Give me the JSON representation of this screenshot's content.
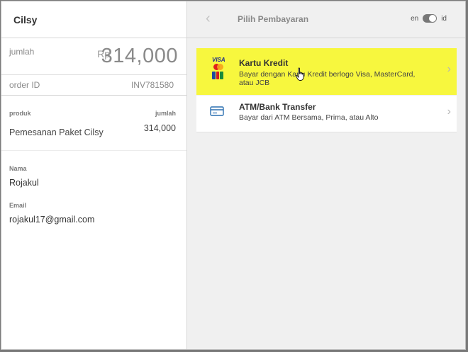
{
  "merchant": {
    "name": "Cilsy"
  },
  "summary": {
    "amount_label": "jumlah",
    "currency": "Rp",
    "amount": "314,000",
    "order_label": "order ID",
    "order_id": "INV781580"
  },
  "items": {
    "header_product": "produk",
    "header_amount": "jumlah",
    "rows": [
      {
        "name": "Pemesanan Paket Cilsy",
        "amount": "314,000"
      }
    ]
  },
  "customer": {
    "name_label": "Nama",
    "name": "Rojakul",
    "email_label": "Email",
    "email": "rojakul17@gmail.com"
  },
  "header": {
    "back_icon": "chevron-left-icon",
    "title": "Pilih Pembayaran",
    "lang_en": "en",
    "lang_id": "id"
  },
  "payment_methods": [
    {
      "title": "Kartu Kredit",
      "description": "Bayar dengan Kartu Kredit berlogo Visa, MasterCard, atau JCB",
      "visa_text": "VISA",
      "highlight_color": "#f7f73e"
    },
    {
      "title": "ATM/Bank Transfer",
      "description": "Bayar dari ATM Bersama, Prima, atau Alto"
    }
  ]
}
